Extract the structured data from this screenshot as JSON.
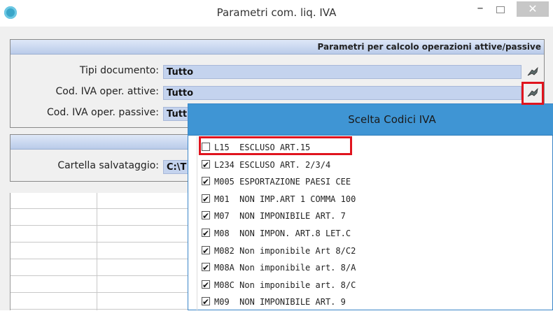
{
  "window": {
    "title": "Parametri com. liq. IVA",
    "minimize": "–",
    "close": "✕",
    "icons": {
      "app": "app-icon",
      "maximize": "maximize-icon"
    }
  },
  "panel1": {
    "header": "Parametri per calcolo operazioni attive/passive",
    "rows": [
      {
        "label": "Tipi documento:",
        "value": "Tutto"
      },
      {
        "label": "Cod. IVA oper. attive:",
        "value": "Tutto"
      },
      {
        "label": "Cod. IVA oper. passive:",
        "value": "Tutt"
      }
    ]
  },
  "panel2": {
    "label": "Cartella salvataggio:",
    "value": "C:\\T"
  },
  "popup": {
    "title": "Scelta Codici IVA",
    "items": [
      {
        "text": "L15  ESCLUSO ART.15",
        "checked": false
      },
      {
        "text": "L234 ESCLUSO ART. 2/3/4",
        "checked": true
      },
      {
        "text": "M005 ESPORTAZIONE PAESI CEE",
        "checked": true
      },
      {
        "text": "M01  NON IMP.ART 1 COMMA 100",
        "checked": true
      },
      {
        "text": "M07  NON IMPONIBILE ART. 7",
        "checked": true
      },
      {
        "text": "M08  NON IMPON. ART.8 LET.C",
        "checked": true
      },
      {
        "text": "M082 Non imponibile Art 8/C2",
        "checked": true
      },
      {
        "text": "M08A Non imponibile art. 8/A",
        "checked": true
      },
      {
        "text": "M08C Non imponibile art. 8/C",
        "checked": true
      },
      {
        "text": "M09  NON IMPONIBILE ART. 9",
        "checked": true
      }
    ]
  },
  "colors": {
    "accent": "#3f95d4",
    "field": "#c4d3ee",
    "highlight": "#e0141e"
  }
}
